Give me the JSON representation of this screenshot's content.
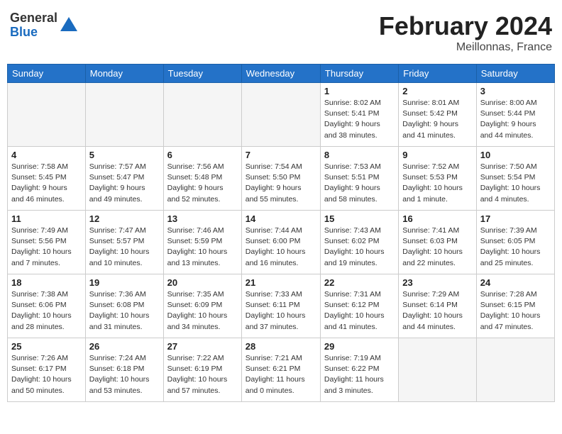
{
  "header": {
    "logo_general": "General",
    "logo_blue": "Blue",
    "title": "February 2024",
    "location": "Meillonnas, France"
  },
  "weekdays": [
    "Sunday",
    "Monday",
    "Tuesday",
    "Wednesday",
    "Thursday",
    "Friday",
    "Saturday"
  ],
  "weeks": [
    [
      {
        "day": "",
        "info": ""
      },
      {
        "day": "",
        "info": ""
      },
      {
        "day": "",
        "info": ""
      },
      {
        "day": "",
        "info": ""
      },
      {
        "day": "1",
        "info": "Sunrise: 8:02 AM\nSunset: 5:41 PM\nDaylight: 9 hours\nand 38 minutes."
      },
      {
        "day": "2",
        "info": "Sunrise: 8:01 AM\nSunset: 5:42 PM\nDaylight: 9 hours\nand 41 minutes."
      },
      {
        "day": "3",
        "info": "Sunrise: 8:00 AM\nSunset: 5:44 PM\nDaylight: 9 hours\nand 44 minutes."
      }
    ],
    [
      {
        "day": "4",
        "info": "Sunrise: 7:58 AM\nSunset: 5:45 PM\nDaylight: 9 hours\nand 46 minutes."
      },
      {
        "day": "5",
        "info": "Sunrise: 7:57 AM\nSunset: 5:47 PM\nDaylight: 9 hours\nand 49 minutes."
      },
      {
        "day": "6",
        "info": "Sunrise: 7:56 AM\nSunset: 5:48 PM\nDaylight: 9 hours\nand 52 minutes."
      },
      {
        "day": "7",
        "info": "Sunrise: 7:54 AM\nSunset: 5:50 PM\nDaylight: 9 hours\nand 55 minutes."
      },
      {
        "day": "8",
        "info": "Sunrise: 7:53 AM\nSunset: 5:51 PM\nDaylight: 9 hours\nand 58 minutes."
      },
      {
        "day": "9",
        "info": "Sunrise: 7:52 AM\nSunset: 5:53 PM\nDaylight: 10 hours\nand 1 minute."
      },
      {
        "day": "10",
        "info": "Sunrise: 7:50 AM\nSunset: 5:54 PM\nDaylight: 10 hours\nand 4 minutes."
      }
    ],
    [
      {
        "day": "11",
        "info": "Sunrise: 7:49 AM\nSunset: 5:56 PM\nDaylight: 10 hours\nand 7 minutes."
      },
      {
        "day": "12",
        "info": "Sunrise: 7:47 AM\nSunset: 5:57 PM\nDaylight: 10 hours\nand 10 minutes."
      },
      {
        "day": "13",
        "info": "Sunrise: 7:46 AM\nSunset: 5:59 PM\nDaylight: 10 hours\nand 13 minutes."
      },
      {
        "day": "14",
        "info": "Sunrise: 7:44 AM\nSunset: 6:00 PM\nDaylight: 10 hours\nand 16 minutes."
      },
      {
        "day": "15",
        "info": "Sunrise: 7:43 AM\nSunset: 6:02 PM\nDaylight: 10 hours\nand 19 minutes."
      },
      {
        "day": "16",
        "info": "Sunrise: 7:41 AM\nSunset: 6:03 PM\nDaylight: 10 hours\nand 22 minutes."
      },
      {
        "day": "17",
        "info": "Sunrise: 7:39 AM\nSunset: 6:05 PM\nDaylight: 10 hours\nand 25 minutes."
      }
    ],
    [
      {
        "day": "18",
        "info": "Sunrise: 7:38 AM\nSunset: 6:06 PM\nDaylight: 10 hours\nand 28 minutes."
      },
      {
        "day": "19",
        "info": "Sunrise: 7:36 AM\nSunset: 6:08 PM\nDaylight: 10 hours\nand 31 minutes."
      },
      {
        "day": "20",
        "info": "Sunrise: 7:35 AM\nSunset: 6:09 PM\nDaylight: 10 hours\nand 34 minutes."
      },
      {
        "day": "21",
        "info": "Sunrise: 7:33 AM\nSunset: 6:11 PM\nDaylight: 10 hours\nand 37 minutes."
      },
      {
        "day": "22",
        "info": "Sunrise: 7:31 AM\nSunset: 6:12 PM\nDaylight: 10 hours\nand 41 minutes."
      },
      {
        "day": "23",
        "info": "Sunrise: 7:29 AM\nSunset: 6:14 PM\nDaylight: 10 hours\nand 44 minutes."
      },
      {
        "day": "24",
        "info": "Sunrise: 7:28 AM\nSunset: 6:15 PM\nDaylight: 10 hours\nand 47 minutes."
      }
    ],
    [
      {
        "day": "25",
        "info": "Sunrise: 7:26 AM\nSunset: 6:17 PM\nDaylight: 10 hours\nand 50 minutes."
      },
      {
        "day": "26",
        "info": "Sunrise: 7:24 AM\nSunset: 6:18 PM\nDaylight: 10 hours\nand 53 minutes."
      },
      {
        "day": "27",
        "info": "Sunrise: 7:22 AM\nSunset: 6:19 PM\nDaylight: 10 hours\nand 57 minutes."
      },
      {
        "day": "28",
        "info": "Sunrise: 7:21 AM\nSunset: 6:21 PM\nDaylight: 11 hours\nand 0 minutes."
      },
      {
        "day": "29",
        "info": "Sunrise: 7:19 AM\nSunset: 6:22 PM\nDaylight: 11 hours\nand 3 minutes."
      },
      {
        "day": "",
        "info": ""
      },
      {
        "day": "",
        "info": ""
      }
    ]
  ]
}
